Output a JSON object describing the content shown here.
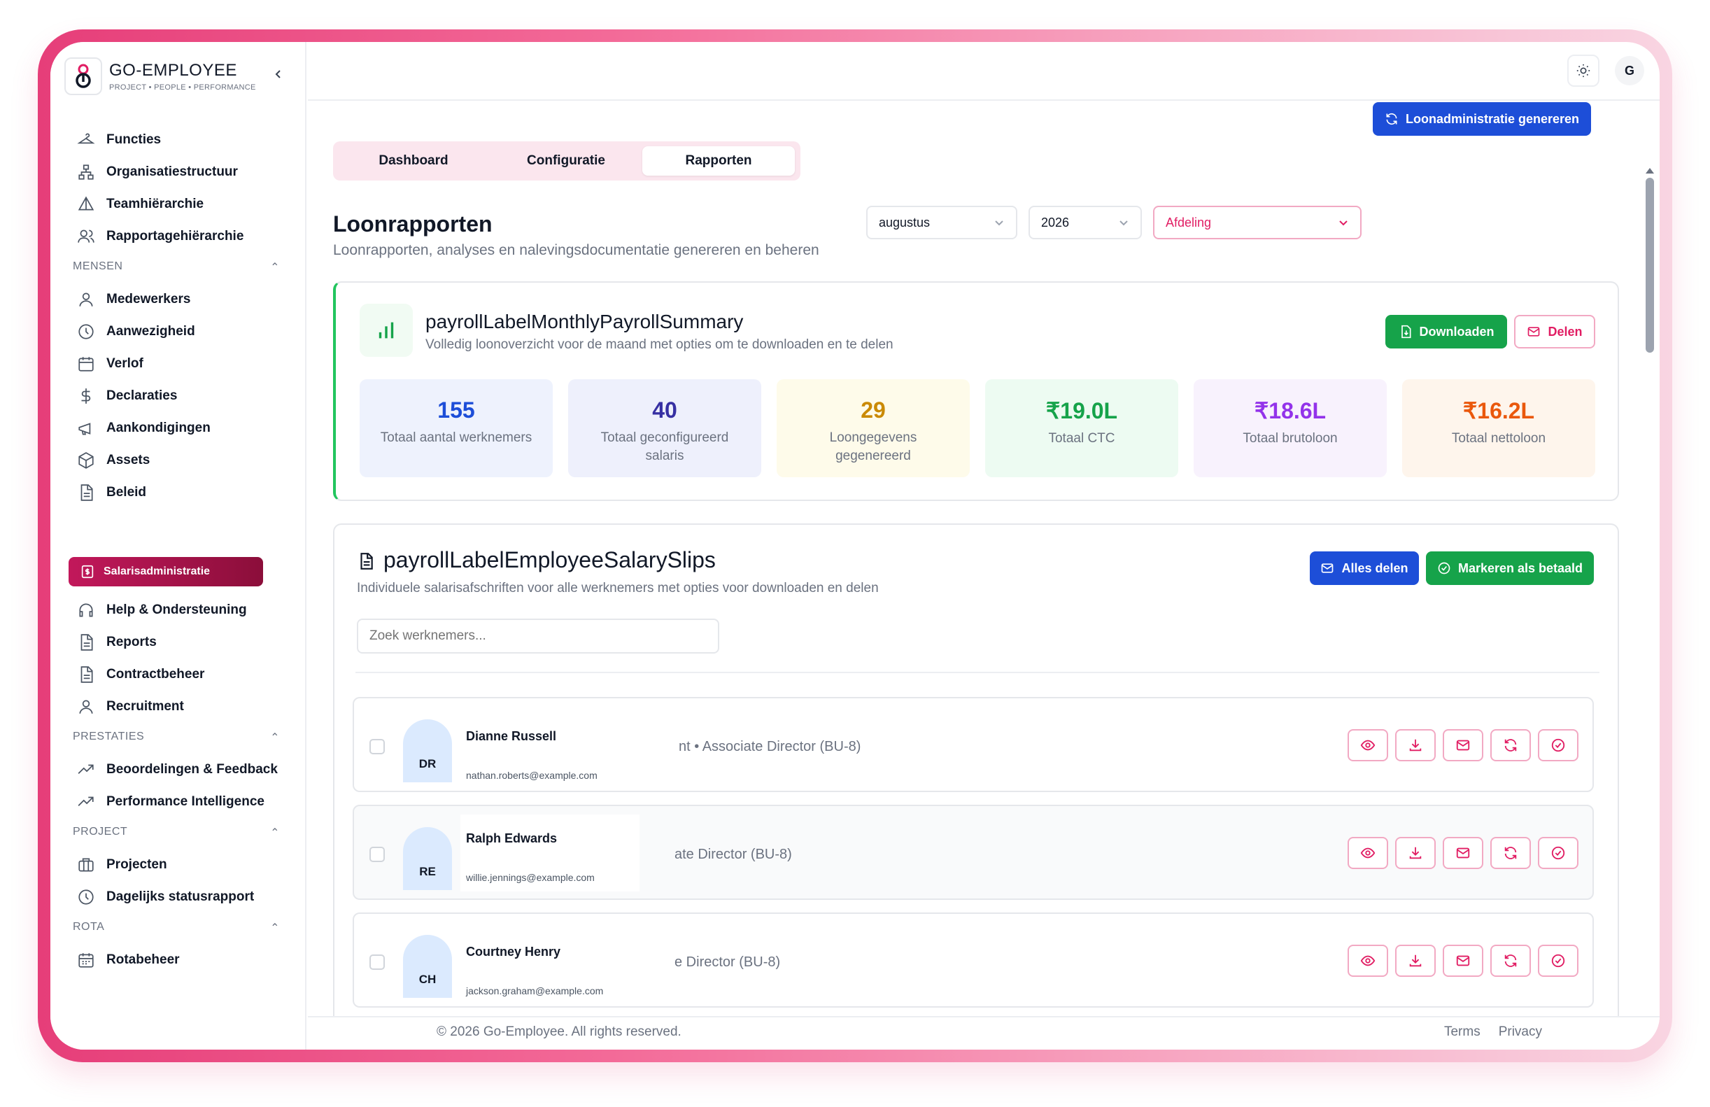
{
  "brand": {
    "name": "GO-EMPLOYEE",
    "tagline": "PROJECT • PEOPLE • PERFORMANCE"
  },
  "sidebar": {
    "top_items": [
      {
        "label": "Functies",
        "icon": "hanger-icon"
      },
      {
        "label": "Organisatiestructuur",
        "icon": "org-chart-icon"
      },
      {
        "label": "Teamhiërarchie",
        "icon": "pyramid-icon"
      },
      {
        "label": "Rapportagehiërarchie",
        "icon": "users-icon"
      }
    ],
    "sections": [
      {
        "title": "MENSEN",
        "items": [
          {
            "label": "Medewerkers",
            "icon": "user-icon"
          },
          {
            "label": "Aanwezigheid",
            "icon": "clock-icon"
          },
          {
            "label": "Verlof",
            "icon": "calendar-icon"
          },
          {
            "label": "Declaraties",
            "icon": "dollar-icon"
          },
          {
            "label": "Aankondigingen",
            "icon": "megaphone-icon"
          },
          {
            "label": "Assets",
            "icon": "box-icon"
          },
          {
            "label": "Beleid",
            "icon": "document-icon"
          },
          {
            "label": "Salarisadministratie",
            "icon": "payroll-icon",
            "active": true
          },
          {
            "label": "Help & Ondersteuning",
            "icon": "headset-icon"
          },
          {
            "label": "Reports",
            "icon": "document-icon"
          },
          {
            "label": "Contractbeheer",
            "icon": "document-icon"
          },
          {
            "label": "Recruitment",
            "icon": "user-icon"
          }
        ]
      },
      {
        "title": "PRESTATIES",
        "items": [
          {
            "label": "Beoordelingen & Feedback",
            "icon": "trend-icon"
          },
          {
            "label": "Performance Intelligence",
            "icon": "trend-icon"
          }
        ]
      },
      {
        "title": "PROJECT",
        "items": [
          {
            "label": "Projecten",
            "icon": "briefcase-icon"
          },
          {
            "label": "Dagelijks statusrapport",
            "icon": "clock-icon"
          }
        ]
      },
      {
        "title": "ROTA",
        "items": [
          {
            "label": "Rotabeheer",
            "icon": "calendar-grid-icon"
          }
        ]
      }
    ]
  },
  "header": {
    "avatar_initial": "G"
  },
  "tabs": [
    "Dashboard",
    "Configuratie",
    "Rapporten"
  ],
  "active_tab": "Rapporten",
  "page": {
    "title": "Loonrapporten",
    "subtitle": "Loonrapporten, analyses en nalevingsdocumentatie genereren en beheren"
  },
  "filters": {
    "month": "augustus",
    "year": "2026",
    "department_placeholder": "Afdeling",
    "generate_label": "Loonadministratie genereren"
  },
  "summary": {
    "title": "payrollLabelMonthlyPayrollSummary",
    "subtitle": "Volledig loonoverzicht voor de maand met opties om te downloaden en te delen",
    "download_label": "Downloaden",
    "share_label": "Delen",
    "stats": [
      {
        "value": "155",
        "label": "Totaal aantal werknemers",
        "color": "#1d4ed8",
        "bg": "#eef2fd"
      },
      {
        "value": "40",
        "label": "Totaal geconfigureerd salaris",
        "color": "#3730a3",
        "bg": "#eef0fc"
      },
      {
        "value": "29",
        "label": "Loongegevens gegenereerd",
        "color": "#ca8a04",
        "bg": "#fefbea"
      },
      {
        "value": "₹19.0L",
        "label": "Totaal CTC",
        "color": "#16a34a",
        "bg": "#edfbf2"
      },
      {
        "value": "₹18.6L",
        "label": "Totaal brutoloon",
        "color": "#9333ea",
        "bg": "#f8f2fd"
      },
      {
        "value": "₹16.2L",
        "label": "Totaal nettoloon",
        "color": "#ea580c",
        "bg": "#fef5ec"
      }
    ]
  },
  "slips": {
    "title": "payrollLabelEmployeeSalarySlips",
    "subtitle": "Individuele salarisafschriften voor alle werknemers met opties voor downloaden en delen",
    "share_all_label": "Alles delen",
    "mark_paid_label": "Markeren als betaald",
    "search_placeholder": "Zoek werknemers...",
    "rows": [
      {
        "initials": "DR",
        "name": "Dianne Russell",
        "email": "nathan.roberts@example.com",
        "role": "nt • Associate Director (BU-8)"
      },
      {
        "initials": "RE",
        "name": "Ralph Edwards",
        "email": "willie.jennings@example.com",
        "role": "ate Director (BU-8)"
      },
      {
        "initials": "CH",
        "name": "Courtney Henry",
        "email": "jackson.graham@example.com",
        "role": "e Director (BU-8)"
      }
    ]
  },
  "footer": {
    "copyright": "© 2026 Go-Employee. All rights reserved.",
    "terms": "Terms",
    "privacy": "Privacy"
  }
}
